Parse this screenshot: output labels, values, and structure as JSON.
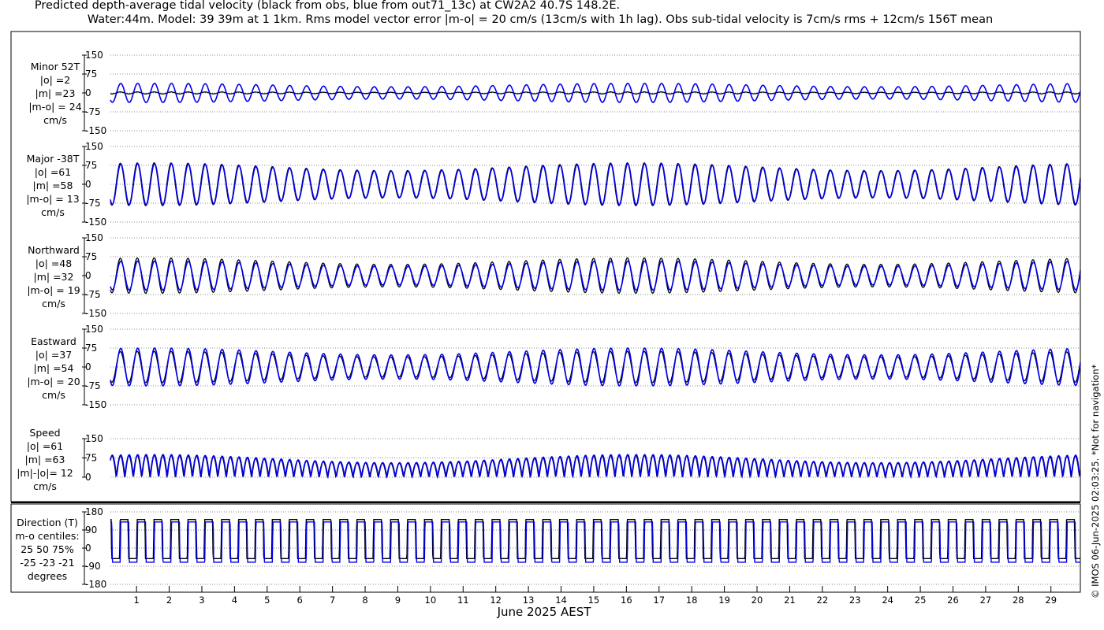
{
  "title": {
    "line1": "Predicted depth-average tidal velocity (black from obs, blue from out71_13c) at CW2A2 40.7S 148.2E.",
    "line2": "Water:44m. Model: 39 39m at 1 1km. Rms model vector error |m-o| = 20 cm/s (13cm/s with 1h lag). Obs sub-tidal velocity is 7cm/s rms + 12cm/s 156T mean"
  },
  "credit": "© IMOS 06-Jun-2025 02:03:25. *Not for navigation*",
  "colors": {
    "obs": "#000000",
    "model": "#0000ee",
    "grid": "#666666"
  },
  "chart_data": {
    "type": "line",
    "xlabel": "June 2025 AEST",
    "x_ticks": [
      "1",
      "2",
      "3",
      "4",
      "5",
      "6",
      "7",
      "8",
      "9",
      "10",
      "11",
      "12",
      "13",
      "14",
      "15",
      "16",
      "17",
      "18",
      "19",
      "20",
      "21",
      "22",
      "23",
      "24",
      "25",
      "26",
      "27",
      "28",
      "29"
    ],
    "x_range_days": [
      0.2,
      29.9
    ],
    "series_legend": {
      "black": "obs",
      "blue": "out71_13c"
    },
    "panels": [
      {
        "id": "minor",
        "label": [
          "Minor 52T",
          "|o| =2",
          "|m| =23",
          "|m-o| = 24",
          "cm/s"
        ],
        "yticks": [
          "150",
          "75",
          "0",
          "-75",
          "-150"
        ],
        "ylim": [
          -150,
          150
        ],
        "obs_amplitude": 4,
        "model_amplitude": 38
      },
      {
        "id": "major",
        "label": [
          "Major -38T",
          "|o| =61",
          "|m| =58",
          "|m-o| = 13",
          "cm/s"
        ],
        "yticks": [
          "150",
          "75",
          "0",
          "-75",
          "-150"
        ],
        "ylim": [
          -150,
          150
        ],
        "obs_amplitude": 85,
        "model_amplitude": 82
      },
      {
        "id": "north",
        "label": [
          "Northward",
          "|o| =48",
          "|m| =32",
          "|m-o| = 19",
          "cm/s"
        ],
        "yticks": [
          "150",
          "75",
          "0",
          "-75",
          "-150"
        ],
        "ylim": [
          -150,
          150
        ],
        "obs_amplitude": 70,
        "model_amplitude": 58
      },
      {
        "id": "east",
        "label": [
          "Eastward",
          "|o| =37",
          "|m| =54",
          "|m-o| = 20",
          "cm/s"
        ],
        "yticks": [
          "150",
          "75",
          "0",
          "-75",
          "-150"
        ],
        "ylim": [
          -150,
          150
        ],
        "obs_amplitude": 62,
        "model_amplitude": 75
      },
      {
        "id": "speed",
        "label": [
          "Speed",
          "|o| =61",
          "|m| =63",
          "|m|-|o|= 12",
          "cm/s"
        ],
        "yticks": [
          "150",
          "75",
          "0"
        ],
        "ylim": [
          0,
          150
        ],
        "obs_amplitude": 85,
        "model_amplitude": 88
      },
      {
        "id": "dir",
        "label": [
          "Direction (T)",
          "m-o centiles:",
          "25  50  75%",
          "-25 -23 -21",
          "degrees"
        ],
        "yticks": [
          "180",
          "90",
          "0",
          "-90",
          "-180"
        ],
        "ylim": [
          -180,
          180
        ],
        "obs_levels": [
          142,
          -52
        ],
        "model_levels": [
          130,
          -70
        ]
      }
    ]
  }
}
